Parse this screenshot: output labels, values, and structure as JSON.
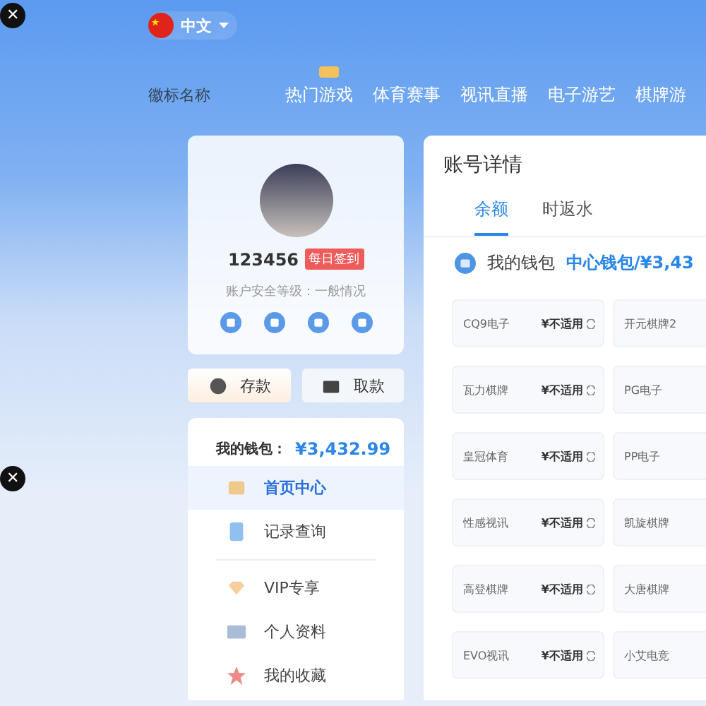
{
  "overlay_buttons": [
    {
      "label": "✕"
    },
    {
      "label": "✕"
    }
  ],
  "header": {
    "language": "中文",
    "logo_alt": "徽标名称",
    "nav": [
      {
        "label": "热门游戏",
        "hot": true
      },
      {
        "label": "体育赛事",
        "hot": false
      },
      {
        "label": "视讯直播",
        "hot": false
      },
      {
        "label": "电子游艺",
        "hot": false
      },
      {
        "label": "棋牌游",
        "hot": false
      }
    ]
  },
  "profile": {
    "username": "123456",
    "checkin": "每日签到",
    "security": "账户安全等级：一般情况"
  },
  "actions": [
    {
      "kind": "deposit",
      "label": "存款"
    },
    {
      "kind": "withdraw",
      "label": "取款"
    }
  ],
  "wallet": {
    "label": "我的钱包：",
    "amount": "¥3,432.99"
  },
  "menu": [
    {
      "kind": "home",
      "label": "首页中心",
      "selected": true
    },
    {
      "kind": "records",
      "label": "记录查询",
      "selected": false
    },
    {
      "kind": "vip",
      "label": "VIP专享",
      "selected": false
    },
    {
      "kind": "profile",
      "label": "个人资料",
      "selected": false
    },
    {
      "kind": "favorite",
      "label": "我的收藏",
      "selected": false
    }
  ],
  "account": {
    "title": "账号详情",
    "tabs": [
      {
        "label": "余额",
        "selected": true
      },
      {
        "label": "时返水",
        "selected": false
      }
    ],
    "wallet_label": "我的钱包",
    "wallet_value": "中心钱包/¥3,43",
    "games": [
      {
        "name": "CQ9电子",
        "amount": "¥不适用"
      },
      {
        "name": "开元棋牌2"
      },
      {
        "name": "瓦力棋牌",
        "amount": "¥不适用"
      },
      {
        "name": "PG电子"
      },
      {
        "name": "皇冠体育",
        "amount": "¥不适用"
      },
      {
        "name": "PP电子"
      },
      {
        "name": "性感视讯",
        "amount": "¥不适用"
      },
      {
        "name": "凯旋棋牌"
      },
      {
        "name": "高登棋牌",
        "amount": "¥不适用"
      },
      {
        "name": "大唐棋牌"
      },
      {
        "name": "EVO视讯",
        "amount": "¥不适用"
      },
      {
        "name": "小艾电竞"
      }
    ]
  }
}
